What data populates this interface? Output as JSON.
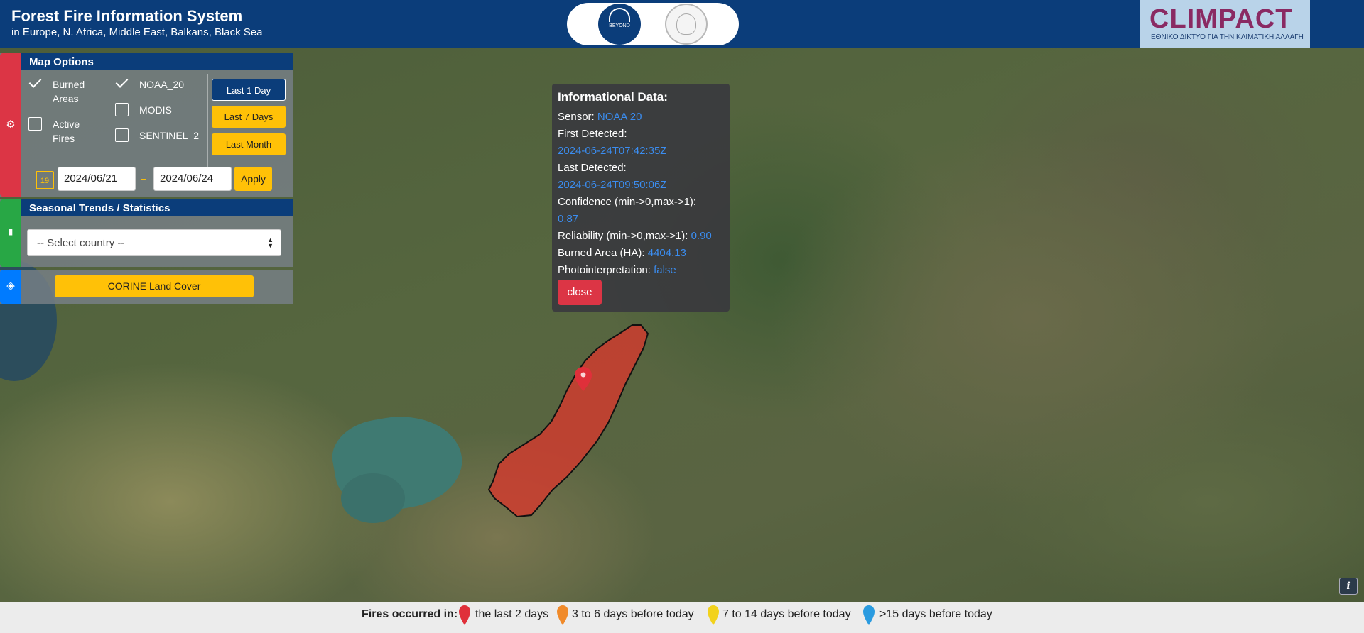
{
  "header": {
    "title": "Forest Fire Information System",
    "subtitle": "in Europe, N. Africa, Middle East, Balkans, Black Sea",
    "logo_beyond_text": "BEYOND",
    "climpact_text": "CLIMPACT",
    "climpact_subtitle": "ΕΘΝΙΚΟ ΔΙΚΤΥΟ ΓΙΑ ΤΗΝ ΚΛΙΜΑΤΙΚΗ ΑΛΛΑΓΗ"
  },
  "map_options": {
    "title": "Map Options",
    "layers": [
      {
        "label_1": "Burned",
        "label_2": "Areas",
        "checked": true
      },
      {
        "label_1": "Active",
        "label_2": "Fires",
        "checked": false
      }
    ],
    "sensors": [
      {
        "label": "NOAA_20",
        "checked": true
      },
      {
        "label": "MODIS",
        "checked": false
      },
      {
        "label": "SENTINEL_2",
        "checked": false
      }
    ],
    "periods": [
      "Last 1 Day",
      "Last 7 Days",
      "Last Month"
    ],
    "active_period": "Last 1 Day",
    "calendar_icon_text": "19",
    "date_from": "2024/06/21",
    "date_separator": "–",
    "date_to": "2024/06/24",
    "apply_label": "Apply"
  },
  "seasonal": {
    "title": "Seasonal Trends / Statistics",
    "select_placeholder": "-- Select country --"
  },
  "layers_panel": {
    "corine_label": "CORINE Land Cover"
  },
  "popup": {
    "title": "Informational Data:",
    "sensor_label": "Sensor:",
    "sensor_value": "NOAA 20",
    "first_detected_label": "First Detected:",
    "first_detected_value": "2024-06-24T07:42:35Z",
    "last_detected_label": "Last Detected:",
    "last_detected_value": "2024-06-24T09:50:06Z",
    "confidence_label": "Confidence (min->0,max->1):",
    "confidence_value": "0.87",
    "reliability_label": "Reliability (min->0,max->1):",
    "reliability_value": "0.90",
    "burned_area_label": "Burned Area (HA):",
    "burned_area_value": "4404.13",
    "photointerpretation_label": "Photointerpretation:",
    "photointerpretation_value": "false",
    "close_label": "close"
  },
  "info_button": "i",
  "legend": {
    "title": "Fires occurred in:",
    "items": [
      {
        "label": "the last 2 days",
        "color": "#e0303a"
      },
      {
        "label": "3 to 6 days before today",
        "color": "#f08a2a"
      },
      {
        "label": "7 to 14 days before today",
        "color": "#f2d21c"
      },
      {
        "label": ">15 days before today",
        "color": "#2a9be0"
      }
    ]
  },
  "colors": {
    "header_blue": "#0b3d7a",
    "accent_yellow": "#ffc107",
    "burn_red": "#d23a2e",
    "link_blue": "#3b8df0"
  }
}
